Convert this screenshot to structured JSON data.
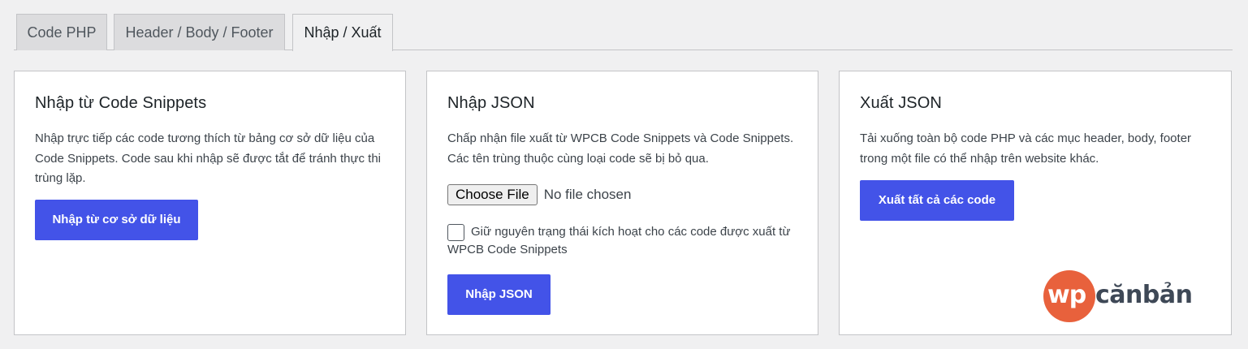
{
  "tabs": [
    {
      "label": "Code PHP",
      "active": false
    },
    {
      "label": "Header / Body / Footer",
      "active": false
    },
    {
      "label": "Nhập / Xuất",
      "active": true
    }
  ],
  "import_snippets": {
    "title": "Nhập từ Code Snippets",
    "description": "Nhập trực tiếp các code tương thích từ bảng cơ sở dữ liệu của Code Snippets. Code sau khi nhập sẽ được tắt để tránh thực thi trùng lặp.",
    "button_label": "Nhập từ cơ sở dữ liệu"
  },
  "import_json": {
    "title": "Nhập JSON",
    "description": "Chấp nhận file xuất từ WPCB Code Snippets và Code Snippets. Các tên trùng thuộc cùng loại code sẽ bị bỏ qua.",
    "file_button_label": "Choose File",
    "file_status": "No file chosen",
    "checkbox_checked": false,
    "checkbox_label": "Giữ nguyên trạng thái kích hoạt cho các code được xuất từ WPCB Code Snippets",
    "button_label": "Nhập JSON"
  },
  "export_json": {
    "title": "Xuất JSON",
    "description": "Tải xuống toàn bộ code PHP và các mục header, body, footer trong một file có thể nhập trên website khác.",
    "button_label": "Xuất tất cả các code"
  },
  "logo": {
    "part1": "wp",
    "part2": "căn bản",
    "part2_display": "cănbản"
  },
  "colors": {
    "accent": "#4353e8",
    "logo_orange": "#e8613c",
    "logo_dark": "#3e4856",
    "background": "#f0f0f1"
  }
}
